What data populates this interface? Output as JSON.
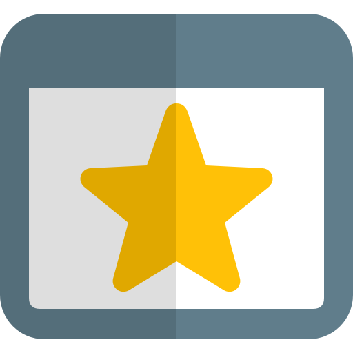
{
  "icon": {
    "name": "favorite-page-icon",
    "glyph": "star-icon"
  },
  "colors": {
    "frame_left": "#546E7A",
    "frame_right": "#607D8B",
    "content_left": "#DEDEDE",
    "content_right": "#FFFFFF",
    "star_left": "#E0A800",
    "star_right": "#FFC107"
  }
}
